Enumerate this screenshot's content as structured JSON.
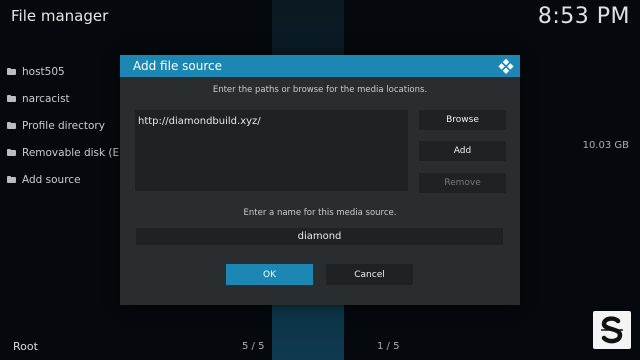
{
  "header": {
    "title": "File manager",
    "clock": "8:53 PM"
  },
  "sources": [
    {
      "label": "host505",
      "icon": "folder-icon"
    },
    {
      "label": "narcacist",
      "icon": "folder-icon"
    },
    {
      "label": "Profile directory",
      "icon": "folder-icon"
    },
    {
      "label": "Removable disk (E:)",
      "icon": "folder-icon"
    },
    {
      "label": "Add source",
      "icon": "folder-icon"
    }
  ],
  "disk_free": "10.03 GB",
  "footer": {
    "path": "Root",
    "left_count": "5 / 5",
    "right_count": "1 / 5"
  },
  "dialog": {
    "title": "Add file source",
    "hint": "Enter the paths or browse for the media locations.",
    "paths": [
      "http://diamondbuild.xyz/"
    ],
    "buttons": {
      "browse": "Browse",
      "add": "Add",
      "remove": "Remove"
    },
    "name_hint": "Enter a name for this media source.",
    "name_value": "diamond",
    "ok": "OK",
    "cancel": "Cancel"
  },
  "colors": {
    "accent": "#1c87b3",
    "panel": "#2a2d30",
    "field": "#1f2225",
    "background": "#05090d"
  }
}
